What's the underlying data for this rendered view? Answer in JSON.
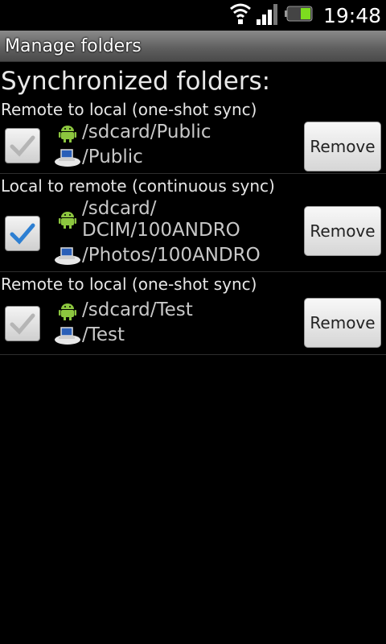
{
  "status": {
    "time": "19:48"
  },
  "title": "Manage folders",
  "heading": "Synchronized folders:",
  "rows": [
    {
      "label": "Remote to local (one-shot sync)",
      "checked": false,
      "local_path": "/sdcard/Public",
      "remote_path": "/Public",
      "remove_label": "Remove"
    },
    {
      "label": "Local to remote (continuous sync)",
      "checked": true,
      "local_path": "/sdcard/\nDCIM/100ANDRO",
      "remote_path": "/Photos/100ANDRO",
      "remove_label": "Remove"
    },
    {
      "label": "Remote to local (one-shot sync)",
      "checked": false,
      "local_path": "/sdcard/Test",
      "remote_path": "/Test",
      "remove_label": "Remove"
    }
  ],
  "colors": {
    "android_green": "#8cc63f",
    "check_blue": "#2d7fd2",
    "check_gray": "#b5b5b5"
  },
  "icons": [
    "wifi-icon",
    "signal-icon",
    "battery-icon",
    "android-icon",
    "computer-icon"
  ]
}
